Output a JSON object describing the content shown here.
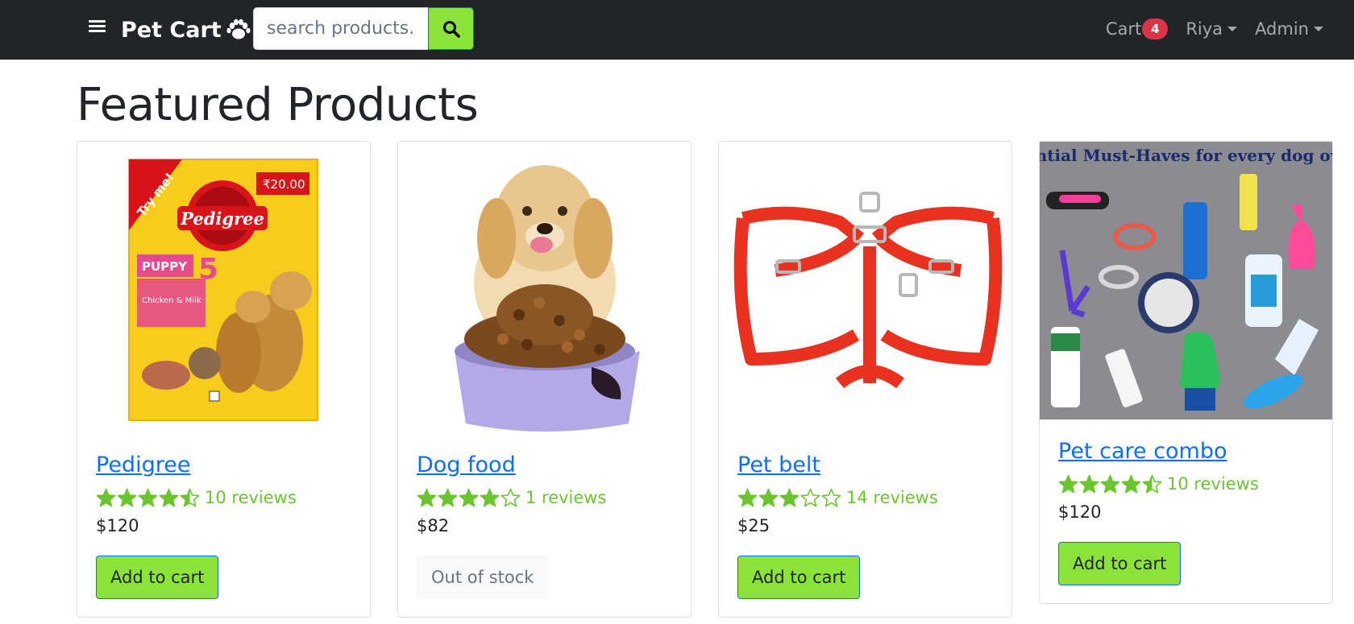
{
  "brand": {
    "name": "Pet Cart",
    "icon": "paw-icon"
  },
  "search": {
    "placeholder": "search products...",
    "button_icon": "search-icon"
  },
  "nav": {
    "cart_label": "Cart",
    "cart_count": "4",
    "user_label": "Riya",
    "admin_label": "Admin"
  },
  "page": {
    "title": "Featured Products"
  },
  "products": [
    {
      "name": "Pedigree",
      "rating": 4.5,
      "reviews": "10 reviews",
      "price": "$120",
      "action": "Add to cart",
      "in_stock": true
    },
    {
      "name": "Dog food",
      "rating": 4,
      "reviews": "1 reviews",
      "price": "$82",
      "action": "Out of stock",
      "in_stock": false
    },
    {
      "name": "Pet belt",
      "rating": 3,
      "reviews": "14 reviews",
      "price": "$25",
      "action": "Add to cart",
      "in_stock": true
    },
    {
      "name": "Pet care combo",
      "rating": 4.5,
      "reviews": "10 reviews",
      "price": "$120",
      "action": "Add to cart",
      "in_stock": true
    }
  ],
  "product_images": [
    {
      "icon": "pedigree-pack-image",
      "colors": {
        "pack": "#f7cc1d",
        "logo": "#d7141a",
        "badge": "#e54a8c"
      },
      "logo_text": "Pedigree",
      "tag_text": "PUPPY",
      "flavor_text": "Chicken & Milk",
      "price_tag": "₹20.00",
      "promo_text": "Try me!"
    },
    {
      "icon": "puppy-with-food-bowl-image",
      "colors": {
        "fur": "#e8c68e",
        "bowl": "#b3a9e6",
        "kibble": "#7a4a1e"
      }
    },
    {
      "icon": "red-harness-image",
      "colors": {
        "strap": "#e8321f",
        "buckle": "#b7b7b7"
      }
    },
    {
      "icon": "dog-essentials-collage-image",
      "colors": {
        "bg": "#8a8c91",
        "title": "#1a2a6c"
      },
      "title_text": "Essential Must-Haves for every dog owner"
    }
  ],
  "colors": {
    "accent_green": "#8be339",
    "link_blue": "#0d6efd",
    "star_green": "#6ac52e",
    "badge_red": "#dc3545",
    "navbar": "#212529"
  }
}
